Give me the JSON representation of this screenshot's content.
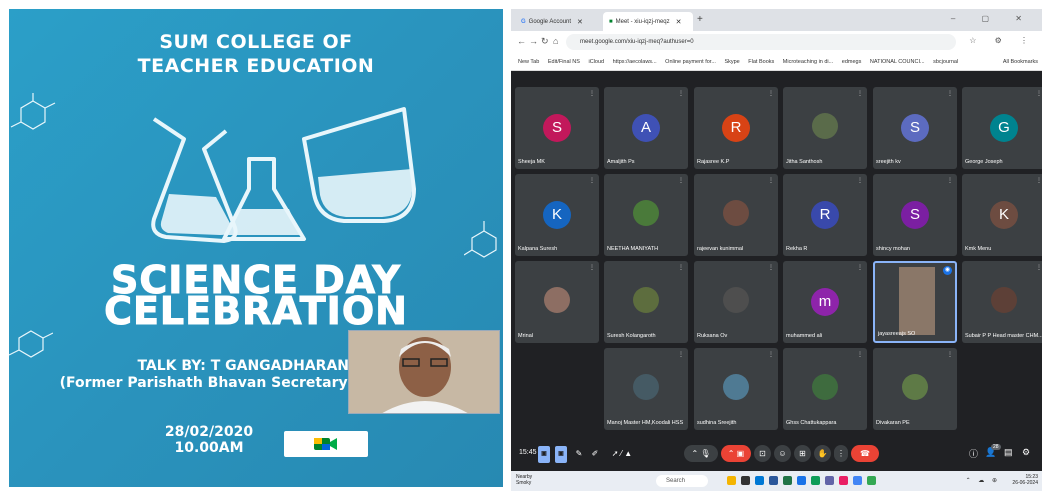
{
  "poster": {
    "college_line1": "SUM COLLEGE OF",
    "college_line2": "TEACHER EDUCATION",
    "headline_line1": "SCIENCE DAY",
    "headline_line2": "CELEBRATION",
    "talk_by": "TALK BY:  T GANGADHARAN",
    "speaker_role": "(Former Parishath Bhavan Secretary)",
    "date": "28/02/2020",
    "time": "10.00AM",
    "colors": {
      "background": "#2b9fc8",
      "text": "#ffffff"
    }
  },
  "browser": {
    "tabs": [
      {
        "label": "Google Account",
        "icon": "google-icon"
      },
      {
        "label": "Meet - xiu-iqzj-meqz",
        "icon": "meet-icon"
      }
    ],
    "url": "meet.google.com/xiu-iqzj-meq?authuser=0",
    "bookmarks": [
      "New Tab",
      "Edit/Final NS",
      "iCloud",
      "https://aecolaws...",
      "Online payment for...",
      "Skype",
      "Flat Books",
      "Microteaching in di...",
      "edmegs",
      "NATIONAL COUNCI...",
      "sbcjournal"
    ],
    "bookmarks_right": "All Bookmarks"
  },
  "meet": {
    "participants": [
      {
        "name": "Sheeja MK",
        "initial": "S",
        "color": "#c2185b",
        "kind": "avatar"
      },
      {
        "name": "Amaljith Ps",
        "initial": "A",
        "color": "#3f51b5",
        "kind": "avatar"
      },
      {
        "name": "Rajasree K.P",
        "initial": "R",
        "color": "#d84315",
        "kind": "avatar"
      },
      {
        "name": "Jitha Santhosh",
        "initial": "",
        "color": "#5a6b4a",
        "kind": "photo"
      },
      {
        "name": "sreejith kv",
        "initial": "S",
        "color": "#5c6bc0",
        "kind": "avatar"
      },
      {
        "name": "George Joseph",
        "initial": "G",
        "color": "#00838f",
        "kind": "avatar"
      },
      {
        "name": "Kalpana Suresh",
        "initial": "K",
        "color": "#1565c0",
        "kind": "avatar"
      },
      {
        "name": "NEETHA MANIYATH",
        "initial": "",
        "color": "#4a7a3a",
        "kind": "photo"
      },
      {
        "name": "rajeevan kunimmal",
        "initial": "",
        "color": "#6d4c41",
        "kind": "photo"
      },
      {
        "name": "Rekha R",
        "initial": "R",
        "color": "#3949ab",
        "kind": "avatar"
      },
      {
        "name": "shincy mohan",
        "initial": "S",
        "color": "#7b1fa2",
        "kind": "avatar"
      },
      {
        "name": "Kmk Menu",
        "initial": "K",
        "color": "#6d4c41",
        "kind": "avatar"
      },
      {
        "name": "Mrinal",
        "initial": "",
        "color": "#8d6e63",
        "kind": "photo"
      },
      {
        "name": "Suresh Kolangaroth",
        "initial": "",
        "color": "#5d6d3e",
        "kind": "photo"
      },
      {
        "name": "Ruksana Ov",
        "initial": "",
        "color": "#4e4e4e",
        "kind": "photo"
      },
      {
        "name": "muhammed ali",
        "initial": "m",
        "color": "#8e24aa",
        "kind": "avatar"
      },
      {
        "name": "jayasreeajs SO",
        "initial": "",
        "color": "#8a7768",
        "kind": "speaking"
      },
      {
        "name": "Subair P P Head master CHM...",
        "initial": "",
        "color": "#5d4037",
        "kind": "photo"
      },
      {
        "name": "Manoj Master HM,Koodali HSS",
        "initial": "",
        "color": "#455a64",
        "kind": "photo"
      },
      {
        "name": "sudhina Sreejith",
        "initial": "",
        "color": "#4f7a93",
        "kind": "photo"
      },
      {
        "name": "Ghss Chattukappara",
        "initial": "",
        "color": "#3e6b3e",
        "kind": "photo"
      },
      {
        "name": "Divakaran PE",
        "initial": "",
        "color": "#5e7a46",
        "kind": "photo"
      }
    ],
    "time": "15:45",
    "participant_count": "28"
  },
  "taskbar": {
    "weather_temp": "Nearby",
    "weather_desc": "Smoky",
    "search_placeholder": "Search",
    "lang": "ENG IN",
    "clock_time": "15:23",
    "clock_date": "26-06-2024"
  }
}
